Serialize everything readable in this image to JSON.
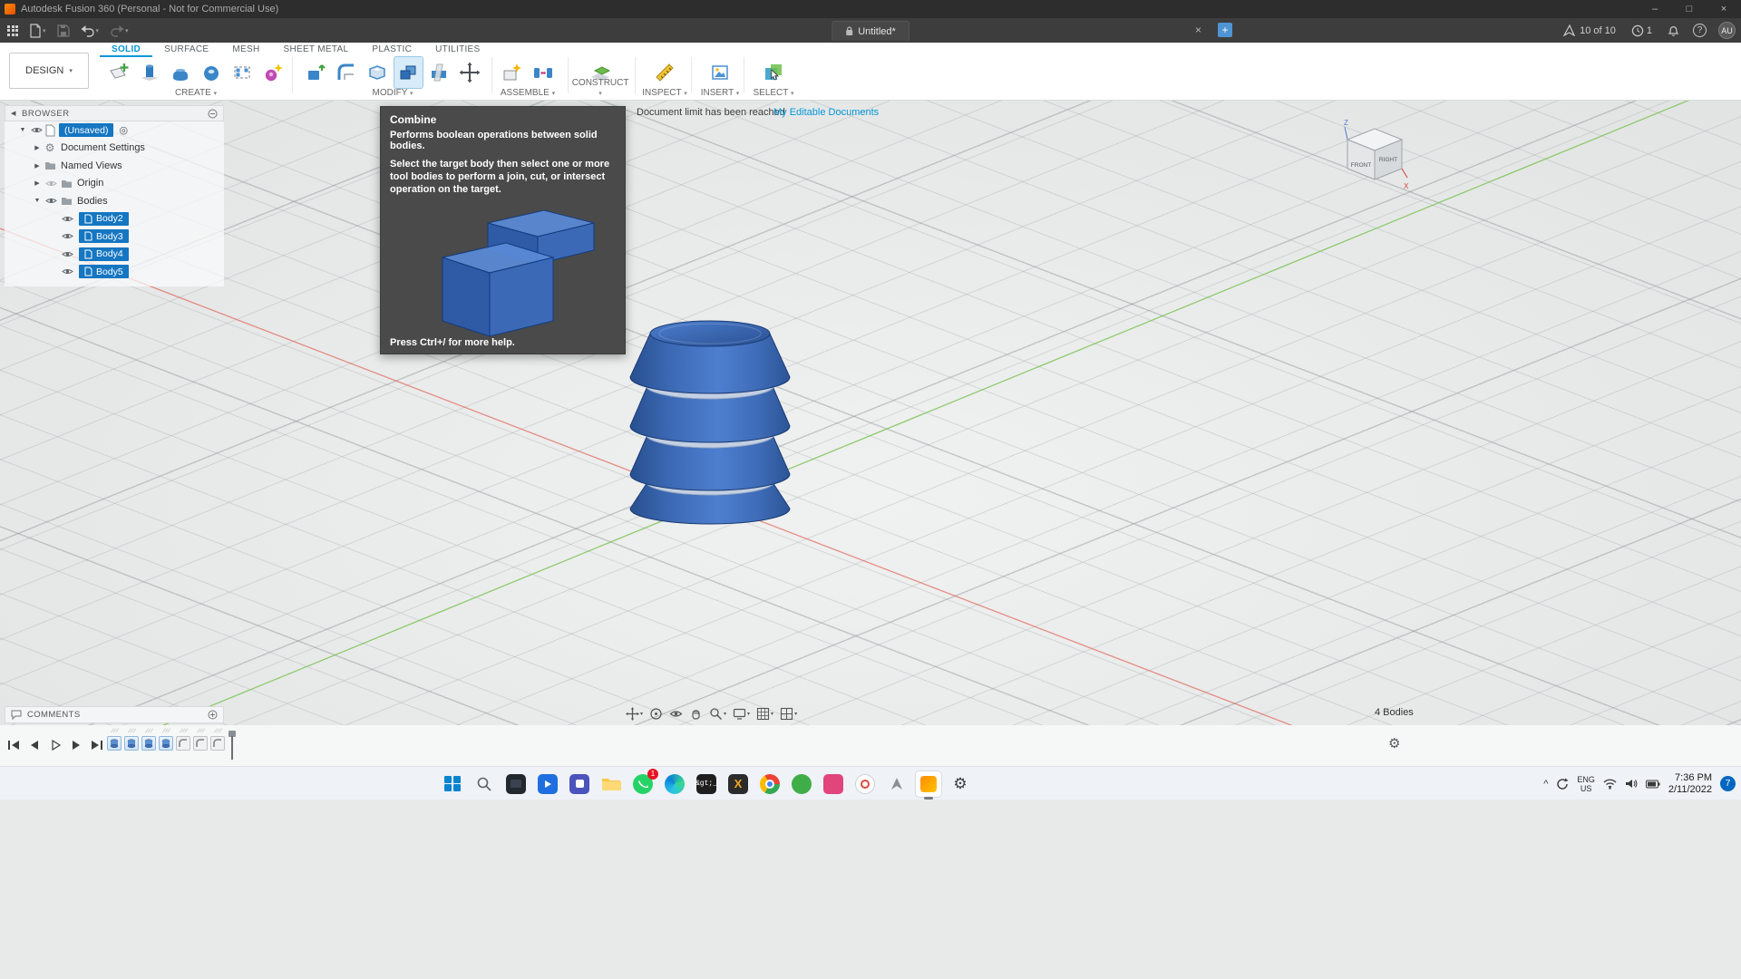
{
  "titlebar": {
    "title": "Autodesk Fusion 360 (Personal - Not for Commercial Use)"
  },
  "appbar": {
    "tab_title": "Untitled*",
    "jobs_status": "10 of 10",
    "clock_badge": "1",
    "avatar_initials": "AU"
  },
  "ribbon": {
    "workspace_label": "DESIGN",
    "tabs": [
      "SOLID",
      "SURFACE",
      "MESH",
      "SHEET METAL",
      "PLASTIC",
      "UTILITIES"
    ],
    "groups": [
      "CREATE",
      "MODIFY",
      "ASSEMBLE",
      "CONSTRUCT",
      "INSPECT",
      "INSERT",
      "SELECT"
    ]
  },
  "browser": {
    "title": "BROWSER",
    "root_label": "(Unsaved)",
    "node_document_settings": "Document Settings",
    "node_named_views": "Named Views",
    "node_origin": "Origin",
    "node_bodies": "Bodies",
    "bodies": [
      "Body2",
      "Body3",
      "Body4",
      "Body5"
    ]
  },
  "tooltip": {
    "title": "Combine",
    "summary": "Performs boolean operations between solid bodies.",
    "description": "Select the target body then select one or more tool bodies to perform a join, cut, or intersect operation on the target.",
    "footer": "Press Ctrl+/ for more help."
  },
  "notices": {
    "doc_limit": "Document limit has been reached",
    "editable_docs": "My Editable Documents"
  },
  "viewcube": {
    "front": "FRONT",
    "right": "RIGHT",
    "axis_z": "Z",
    "axis_x": "X"
  },
  "statusbar": {
    "bodies_count": "4 Bodies"
  },
  "comments": {
    "title": "COMMENTS"
  },
  "taskbar": {
    "time": "7:36 PM",
    "date": "2/11/2022",
    "lang_top": "ENG",
    "lang_bottom": "US",
    "notification_badge": "7",
    "whatsapp_badge": "1",
    "terminal_glyph": "&gt;_",
    "x_glyph": "X"
  },
  "icons": {
    "caret": "▾",
    "collapsed": "▶",
    "expanded": "▼",
    "back": "◀",
    "gear": "⚙",
    "close": "×",
    "minimize": "–",
    "maximize": "□",
    "plus": "+",
    "help": "?",
    "target": "◎",
    "chevron_up": "^",
    "slashes": "///"
  },
  "colors": {
    "accent": "#0696d7",
    "selection": "#1576c2",
    "body_blue": "#3a68b8",
    "axis_green": "#72bf44",
    "axis_red": "#e2574b"
  }
}
